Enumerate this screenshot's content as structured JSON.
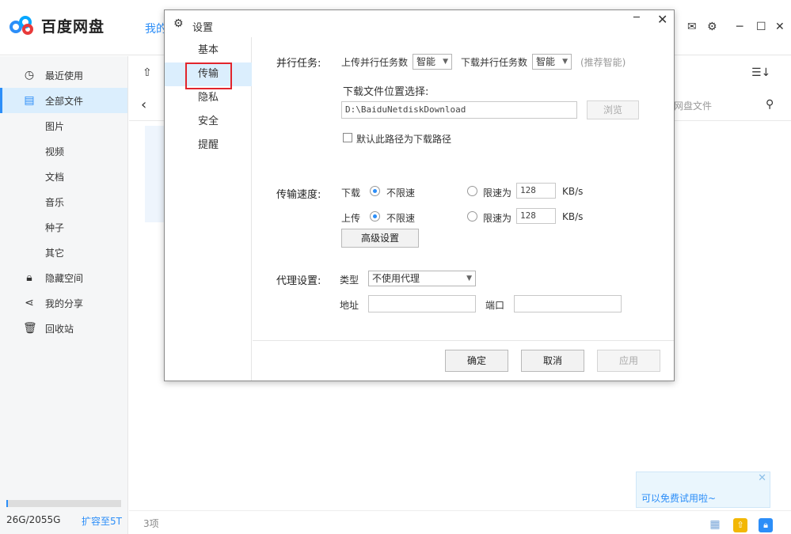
{
  "app": {
    "name": "百度网盘",
    "top_tab": "我的"
  },
  "sidebar": {
    "items": [
      {
        "label": "最近使用",
        "icon": "clock-icon"
      },
      {
        "label": "全部文件",
        "icon": "document-icon"
      },
      {
        "label": "图片"
      },
      {
        "label": "视频"
      },
      {
        "label": "文档"
      },
      {
        "label": "音乐"
      },
      {
        "label": "种子"
      },
      {
        "label": "其它"
      },
      {
        "label": "隐藏空间",
        "icon": "lock-icon"
      },
      {
        "label": "我的分享",
        "icon": "share-icon"
      },
      {
        "label": "回收站",
        "icon": "trash-icon"
      }
    ],
    "quota": "26G/2055G",
    "upgrade": "扩容至5T"
  },
  "main": {
    "search_placeholder": "网盘文件",
    "item_count": "3项"
  },
  "promo": {
    "text": "可以免费试用啦~"
  },
  "dialog": {
    "title": "设置",
    "nav": [
      "基本",
      "传输",
      "隐私",
      "安全",
      "提醒"
    ],
    "parallel": {
      "label": "并行任务:",
      "upload_label": "上传并行任务数",
      "upload_value": "智能",
      "download_label": "下载并行任务数",
      "download_value": "智能",
      "hint": "(推荐智能)"
    },
    "download_path": {
      "label": "下载文件位置选择:",
      "value": "D:\\BaiduNetdiskDownload",
      "browse": "浏览",
      "default_check": "默认此路径为下载路径"
    },
    "speed": {
      "label": "传输速度:",
      "download": "下载",
      "upload": "上传",
      "unlimited": "不限速",
      "limit_to": "限速为",
      "download_limit": "128",
      "upload_limit": "128",
      "unit": "KB/s",
      "advanced": "高级设置"
    },
    "proxy": {
      "label": "代理设置:",
      "type_label": "类型",
      "type_value": "不使用代理",
      "address_label": "地址",
      "port_label": "端口"
    },
    "buttons": {
      "ok": "确定",
      "cancel": "取消",
      "apply": "应用"
    }
  }
}
